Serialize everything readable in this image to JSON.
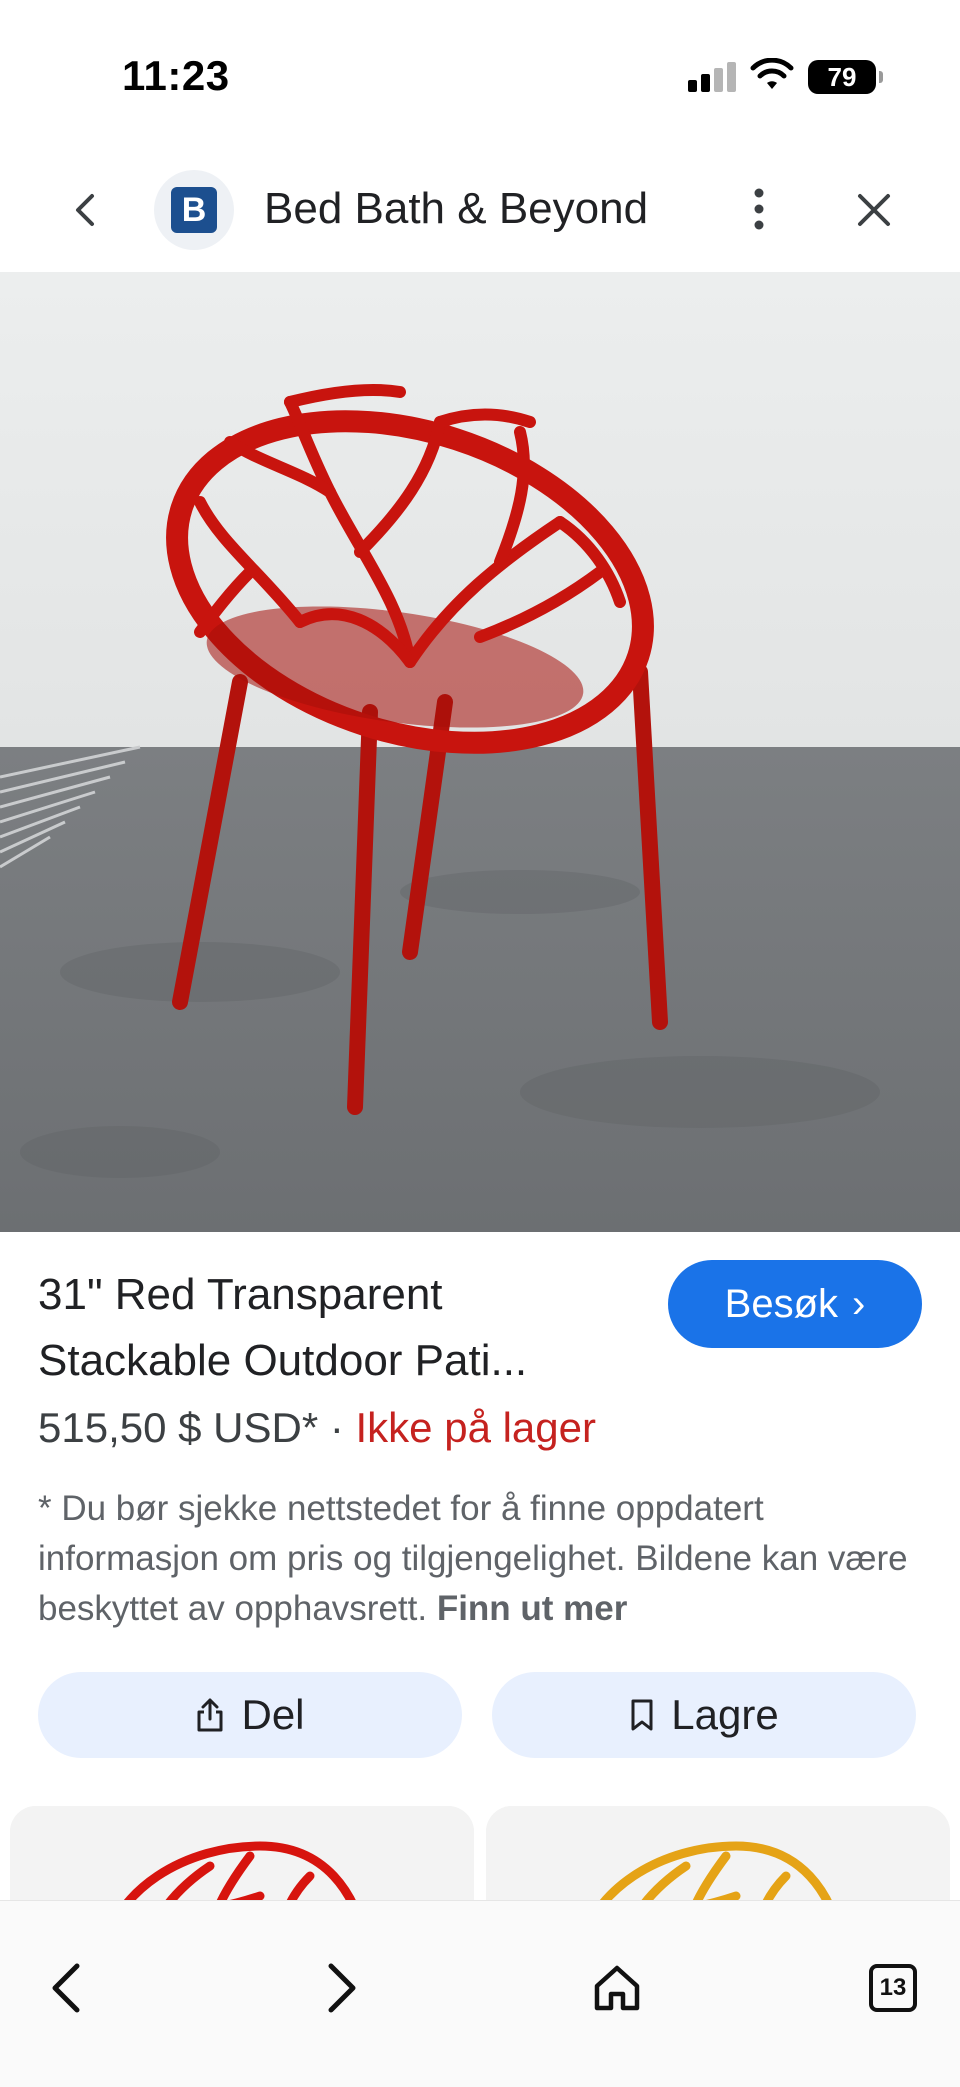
{
  "status_bar": {
    "time": "11:23",
    "battery_level": "79"
  },
  "header": {
    "site_name": "Bed Bath & Beyond",
    "logo_letter": "B"
  },
  "product": {
    "title": "31\" Red Transparent Stackable Outdoor Pati...",
    "price": "515,50 $ USD*",
    "separator": " · ",
    "stock_status": "Ikke på lager",
    "visit_label": "Besøk",
    "visit_chevron": "›",
    "disclaimer": "* Du bør sjekke nettstedet for å finne oppdatert informasjon om pris og tilgjengelighet. Bildene kan være beskyttet av opphavsrett. ",
    "learn_more": "Finn ut mer"
  },
  "actions": {
    "share_label": "Del",
    "save_label": "Lagre"
  },
  "browser_bar": {
    "tab_count": "13"
  },
  "colors": {
    "accent": "#1a73e8",
    "out_of_stock": "#c5221f",
    "action_bg": "#e8f0fe",
    "chair_red": "#c8140e"
  }
}
